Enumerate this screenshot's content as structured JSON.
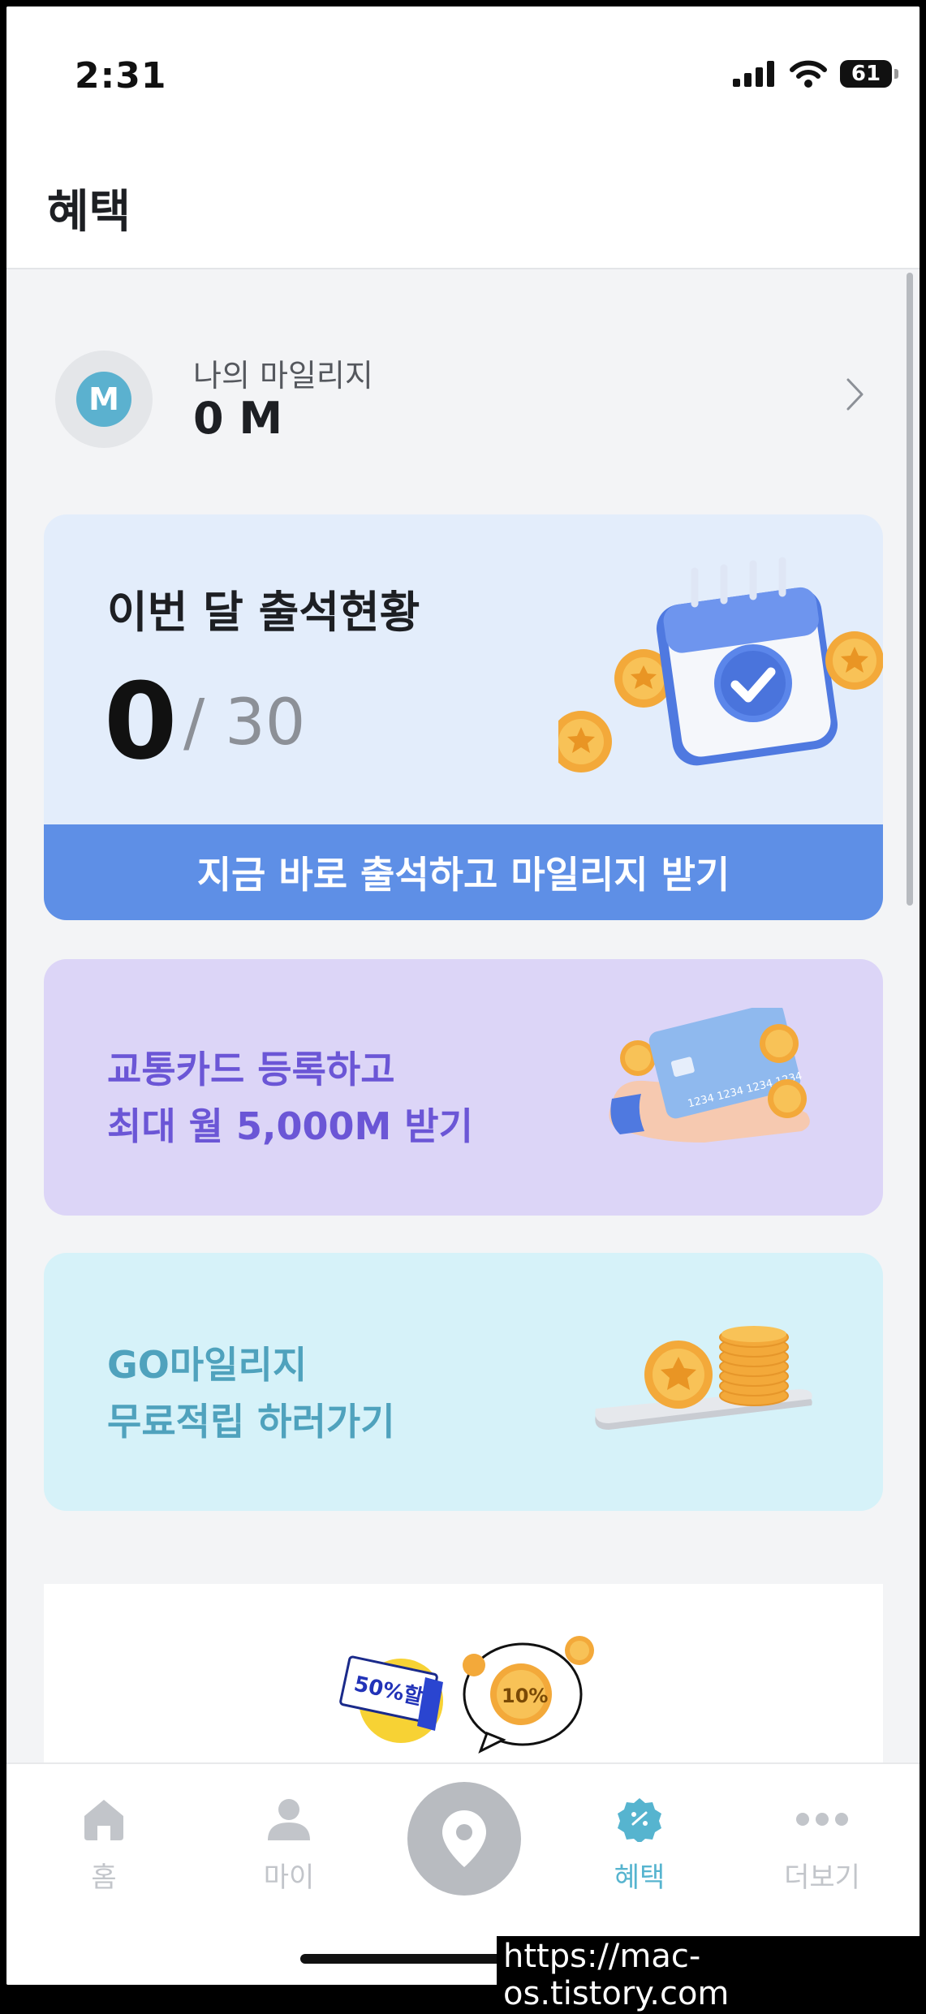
{
  "status_bar": {
    "time": "2:31",
    "battery": "61"
  },
  "header": {
    "title": "혜택"
  },
  "mileage": {
    "avatar_letter": "M",
    "label": "나의 마일리지",
    "value": "0 M"
  },
  "attendance": {
    "title": "이번 달 출석현황",
    "count": "0",
    "total": "/ 30",
    "button_label": "지금 바로 출석하고 마일리지 받기"
  },
  "transit_card": {
    "line1": "교통카드 등록하고",
    "line2": "최대 월 5,000M 받기",
    "illus_digits": "1234 1234 1234 1234"
  },
  "go_card": {
    "line1": "GO마일리지",
    "line2": "무료적립 하러가기"
  },
  "promo": {
    "coupon_text": "50%할인",
    "coin_text": "10%"
  },
  "tab_bar": {
    "items": [
      {
        "label": "홈",
        "icon": "home-icon",
        "active": false
      },
      {
        "label": "마이",
        "icon": "person-icon",
        "active": false
      },
      {
        "label": "",
        "icon": "location-pin-icon",
        "active": false
      },
      {
        "label": "혜택",
        "icon": "benefit-badge-icon",
        "active": true
      },
      {
        "label": "더보기",
        "icon": "more-dots-icon",
        "active": false
      }
    ]
  },
  "watermark": "https://mac-os.tistory.com",
  "colors": {
    "accent": "#56b4cf",
    "attendance_button": "#5e8fe6",
    "transit_text": "#6b56d6",
    "go_text": "#4fa2bd"
  }
}
